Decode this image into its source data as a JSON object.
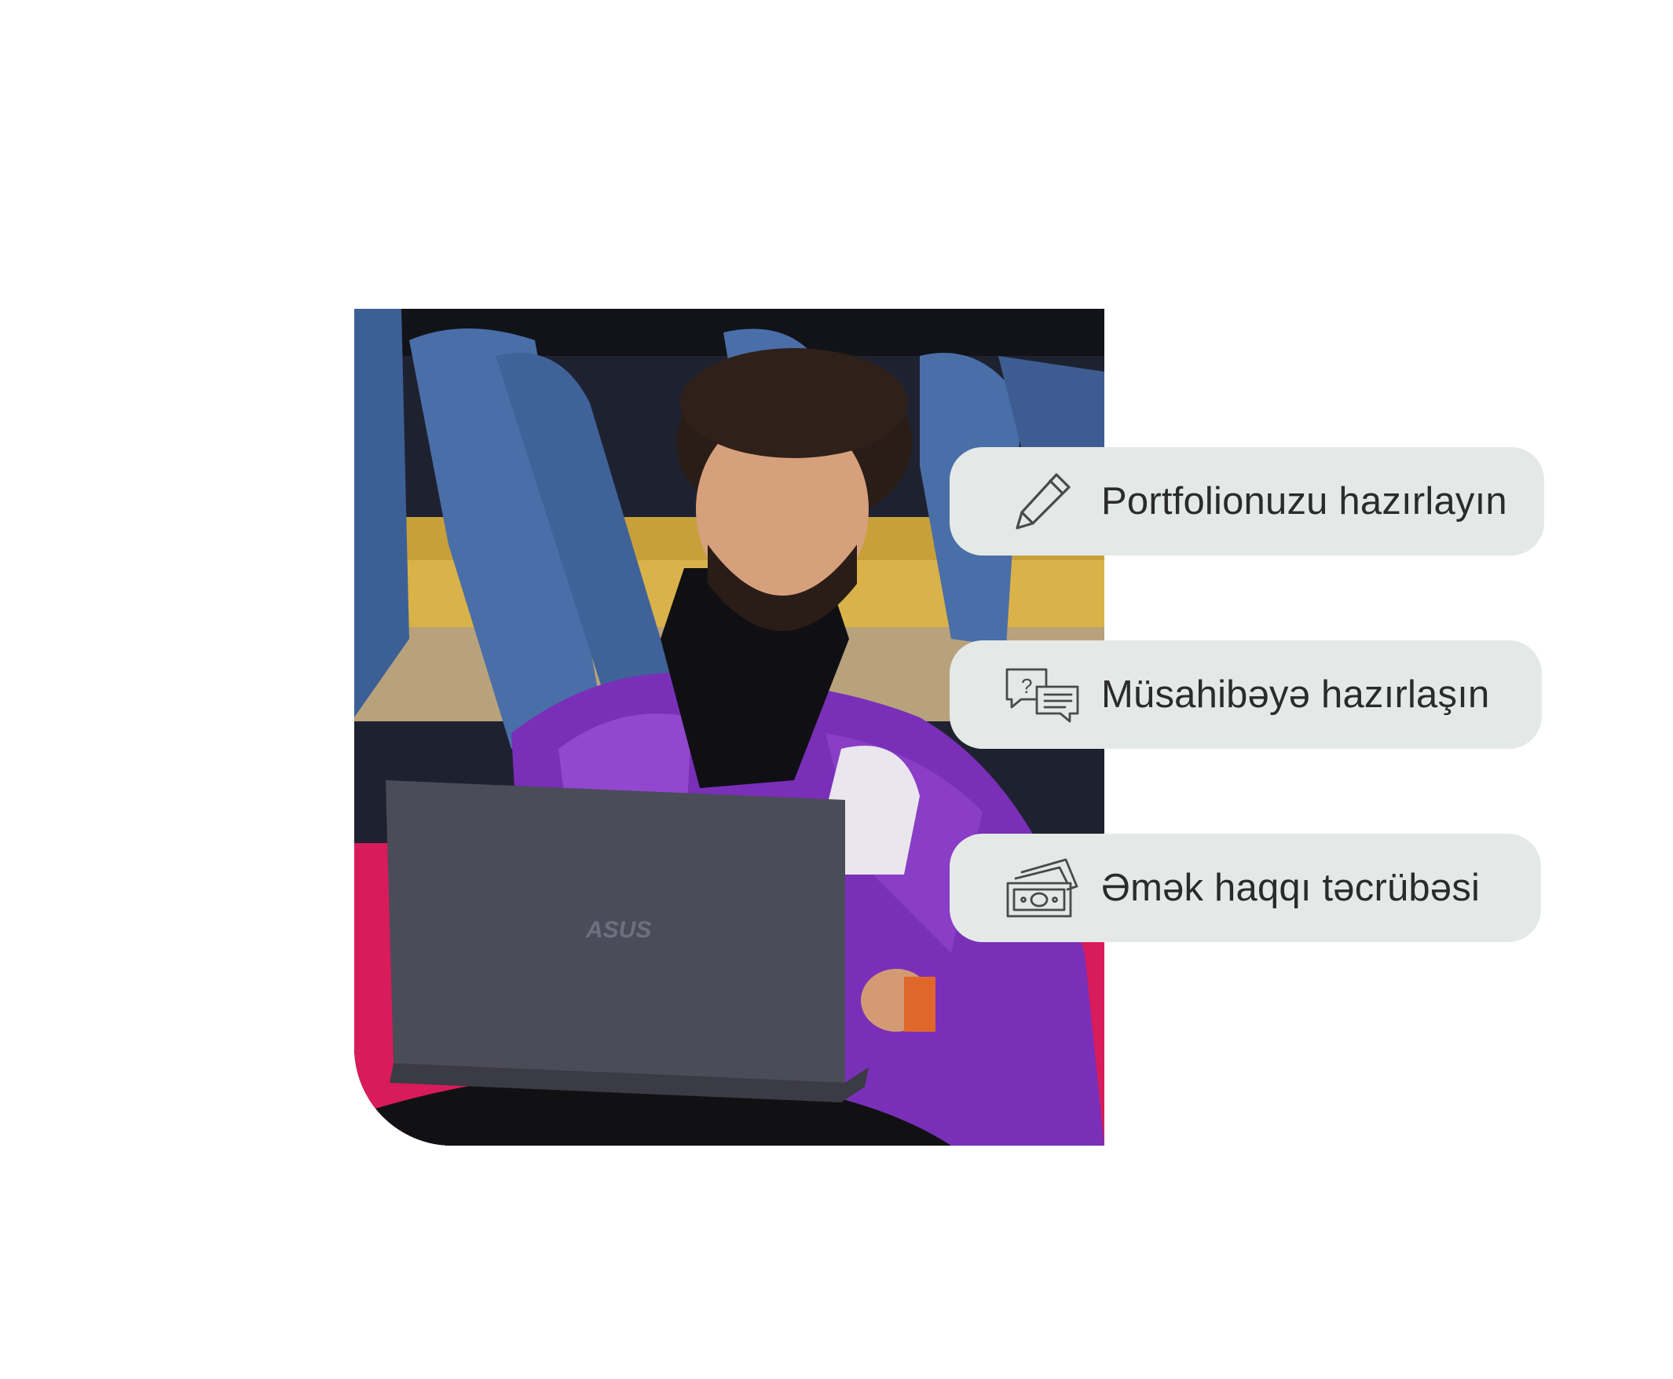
{
  "photo": {
    "subject": "student-with-laptop",
    "laptop_brand_text": "ASUS"
  },
  "features": [
    {
      "icon": "pencil-icon",
      "label": "Portfolionuzu hazırlayın"
    },
    {
      "icon": "chat-question-icon",
      "label": "Müsahibəyə hazırlaşın"
    },
    {
      "icon": "money-bills-icon",
      "label": "Əmək haqqı təcrübəsi"
    }
  ],
  "colors": {
    "pill_background": "#e4e9e7",
    "text": "#2b2b2b",
    "icon_stroke": "#4a4a4a",
    "jacket": "#7a2fb8",
    "seat": "#d81b5a"
  }
}
